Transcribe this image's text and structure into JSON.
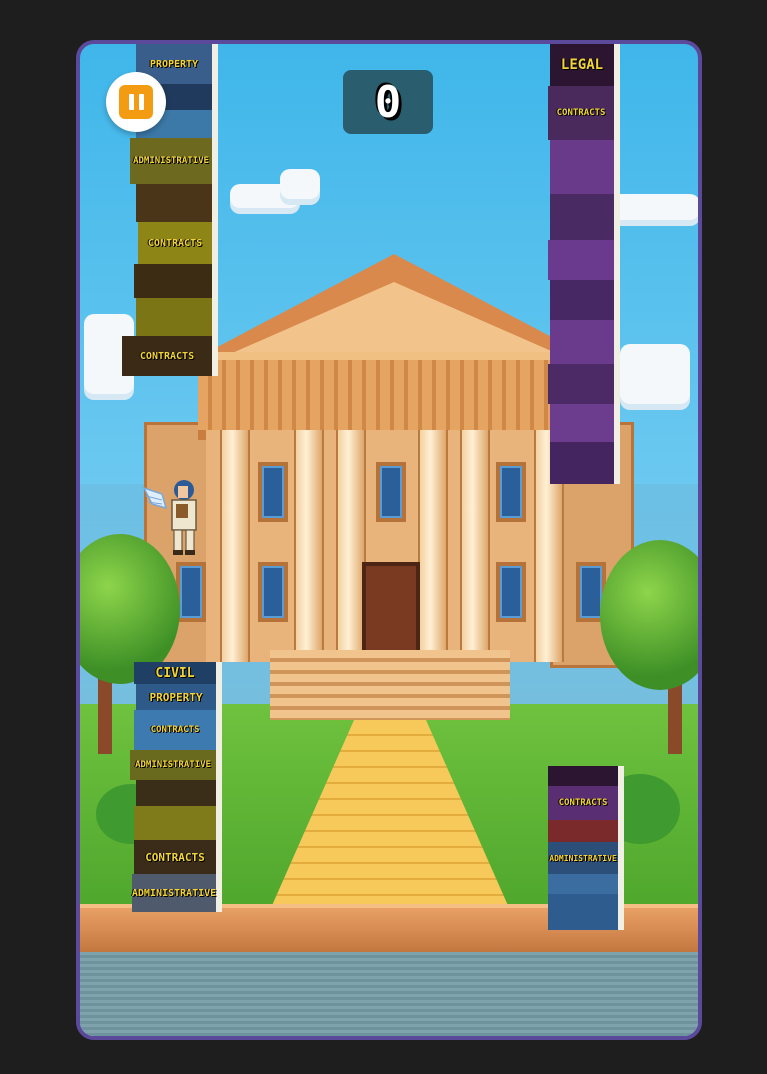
{
  "hud": {
    "score": "0",
    "pause_icon": "pause-icon"
  },
  "colors": {
    "frame": "#5b4a9c",
    "pause": "#f39c12",
    "score_bg": "#2a5e6e"
  },
  "towers": {
    "top_left": [
      {
        "label": "PROPERTY",
        "color": "#3a5e8c"
      },
      {
        "label": "",
        "color": "#1f3a5c"
      },
      {
        "label": "",
        "color": "#3c79a8"
      },
      {
        "label": "ADMINISTRATIVE",
        "color": "#6d6a1f"
      },
      {
        "label": "",
        "color": "#4a3518"
      },
      {
        "label": "CONTRACTS",
        "color": "#8d8516"
      },
      {
        "label": "",
        "color": "#3d2c14"
      },
      {
        "label": "",
        "color": "#7b7516"
      },
      {
        "label": "CONTRACTS",
        "color": "#3a2a16"
      }
    ],
    "top_right": [
      {
        "label": "LEGAL",
        "color": "#2b1530"
      },
      {
        "label": "CONTRACTS",
        "color": "#4a2a5c"
      },
      {
        "label": "",
        "color": "#6a3a8a"
      },
      {
        "label": "",
        "color": "#4a2a62"
      },
      {
        "label": "",
        "color": "#6a3a8e"
      },
      {
        "label": "",
        "color": "#472864"
      },
      {
        "label": "",
        "color": "#6a3a8c"
      },
      {
        "label": "",
        "color": "#4b2a66"
      },
      {
        "label": "",
        "color": "#6c3c8e"
      },
      {
        "label": "",
        "color": "#452560"
      }
    ],
    "bottom_left": [
      {
        "label": "CIVIL",
        "color": "#1f3f64"
      },
      {
        "label": "PROPERTY",
        "color": "#2e5a8a"
      },
      {
        "label": "CONTRACTS",
        "color": "#3c7ab0"
      },
      {
        "label": "ADMINISTRATIVE",
        "color": "#6a6a1e"
      },
      {
        "label": "",
        "color": "#3b2e18"
      },
      {
        "label": "",
        "color": "#7f7b1a"
      },
      {
        "label": "CONTRACTS",
        "color": "#3a2c18"
      },
      {
        "label": "ADMINISTRATIVE",
        "color": "#4f5a6c"
      }
    ],
    "bottom_right": [
      {
        "label": "",
        "color": "#2b1530"
      },
      {
        "label": "CONTRACTS",
        "color": "#5a2e72"
      },
      {
        "label": "",
        "color": "#7a2a2a"
      },
      {
        "label": "ADMINISTRATIVE",
        "color": "#2c4f7a"
      },
      {
        "label": "",
        "color": "#3b6da0"
      },
      {
        "label": "",
        "color": "#2f5c8e"
      }
    ]
  }
}
